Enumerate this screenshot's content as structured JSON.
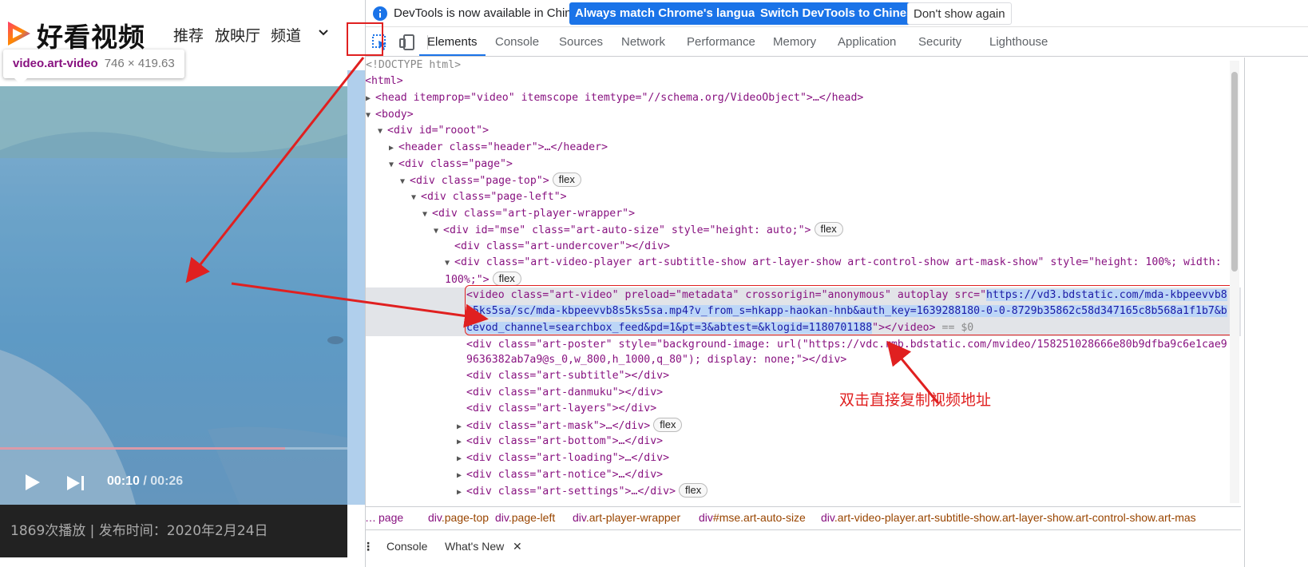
{
  "site": {
    "logo_text": "好看视频",
    "nav": [
      "推荐",
      "放映厅",
      "频道"
    ],
    "inspect_tip": {
      "selector": "video.art-video",
      "dimensions": "746 × 419.63"
    },
    "player": {
      "current_time": "00:10",
      "total_time": "/ 00:26",
      "progress": 0.82
    },
    "meta": "1869次播放 | 发布时间：2020年2月24日"
  },
  "devtools": {
    "infobar": {
      "message": "DevTools is now available in Chinese!",
      "buttons": [
        "Always match Chrome's language",
        "Switch DevTools to Chinese",
        "Don't show again"
      ]
    },
    "tabs": [
      "Elements",
      "Console",
      "Sources",
      "Network",
      "Performance",
      "Memory",
      "Application",
      "Security",
      "Lighthouse"
    ],
    "active_tab": "Elements",
    "dom": {
      "doctype": "<!DOCTYPE html>",
      "html_open": "<html>",
      "head_line": "<head itemprop=\"video\" itemscope itemtype=\"//schema.org/VideoObject\">…</head>",
      "body_open": "<body>",
      "div_rooot": "<div id=\"rooot\">",
      "header_line": "<header class=\"header\">…</header>",
      "div_page": "<div class=\"page\">",
      "div_page_top": "<div class=\"page-top\">",
      "div_page_left": "<div class=\"page-left\">",
      "div_wrapper": "<div class=\"art-player-wrapper\">",
      "div_mse": "<div id=\"mse\" class=\"art-auto-size\" style=\"height: auto;\">",
      "div_undercover": "<div class=\"art-undercover\"></div>",
      "div_video_player_1": "<div class=\"art-video-player art-subtitle-show art-layer-show art-control-show art-mask-show\" style=\"height: 100%; width:",
      "div_video_player_2": "100%;\">",
      "video_line_prefix": "<video class=\"art-video\" preload=\"metadata\" crossorigin=\"anonymous\" autoplay src=\"",
      "video_src_1": "https://vd3.bdstatic.com/mda-kbpeevvb8",
      "video_src_2": "s5ks5sa/sc/mda-kbpeevvb8s5ks5sa.mp4?v_from_s=hkapp-haokan-hnb&auth_key=1639288180-0-0-8729b35862c58d347165c8b568a1f1b7&b",
      "video_src_3": "cevod_channel=searchbox_feed&pd=1&pt=3&abtest=&klogid=1180701188",
      "video_close": "\"></video>",
      "video_marker": "== $0",
      "poster_1": "<div class=\"art-poster\" style=\"background-image: url(\"https://vdc.rmb.bdstatic.com/mvideo/158251028666e80b9dfba9c6e1cae9",
      "poster_2": "9636382ab7a9@s_0,w_800,h_1000,q_80\"); display: none;\"></div>",
      "children": [
        "<div class=\"art-subtitle\"></div>",
        "<div class=\"art-danmuku\"></div>",
        "<div class=\"art-layers\"></div>",
        "<div class=\"art-mask\">…</div>",
        "<div class=\"art-bottom\">…</div>",
        "<div class=\"art-loading\">…</div>",
        "<div class=\"art-notice\">…</div>",
        "<div class=\"art-settings\">…</div>"
      ],
      "flex_badge": "flex"
    },
    "breadcrumb": [
      {
        "tag": "…",
        "cls": ""
      },
      {
        "tag": "page",
        "cls": ""
      },
      {
        "tag": "div",
        "cls": ".page-top"
      },
      {
        "tag": "div",
        "cls": ".page-left"
      },
      {
        "tag": "div",
        "cls": ".art-player-wrapper"
      },
      {
        "tag": "div",
        "cls": "#mse.art-auto-size"
      },
      {
        "tag": "div",
        "cls": ".art-video-player.art-subtitle-show.art-layer-show.art-control-show.art-mas"
      }
    ],
    "drawer_tabs": [
      "Console",
      "What's New"
    ]
  },
  "annotation": "双击直接复制视频地址",
  "colors": {
    "accent_blue": "#1a73e8",
    "annotation_red": "#e02020",
    "tag": "#881280",
    "attr": "#994500",
    "value": "#1a1aa6"
  }
}
